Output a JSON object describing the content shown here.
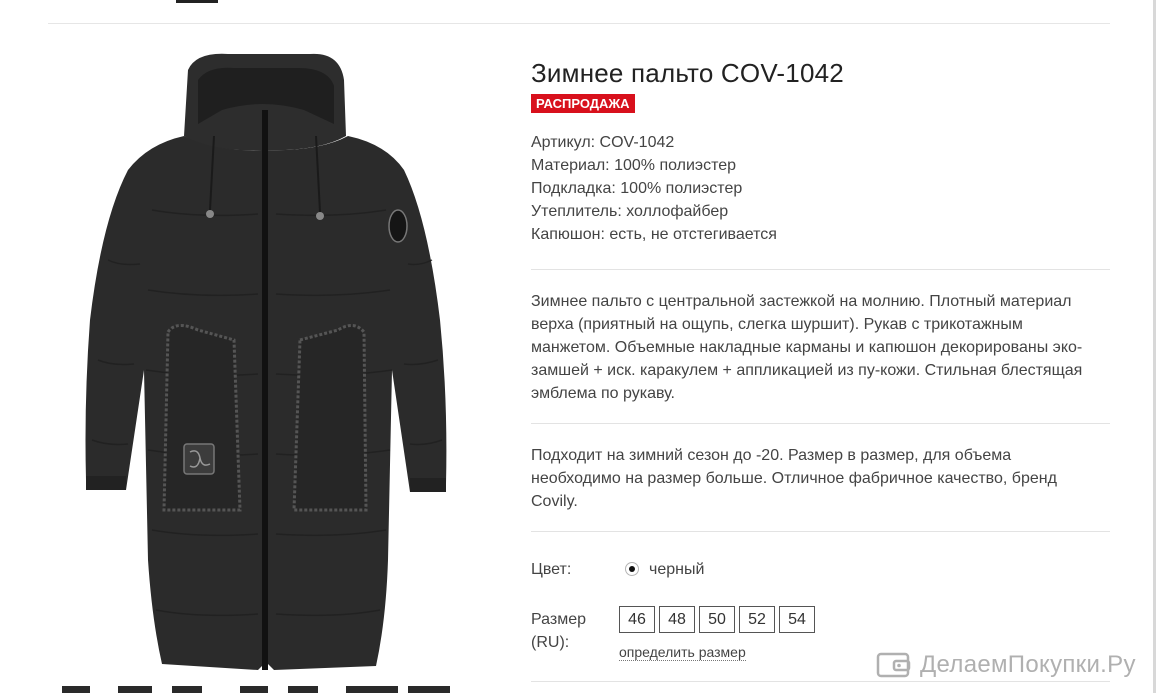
{
  "product": {
    "title": "Зимнее пальто COV-1042",
    "badge": "РАСПРОДАЖА",
    "specs": [
      {
        "label": "Артикул:",
        "value": "COV-1042"
      },
      {
        "label": "Материал:",
        "value": "100% полиэстер"
      },
      {
        "label": "Подкладка:",
        "value": "100% полиэстер"
      },
      {
        "label": "Утеплитель:",
        "value": "холлофайбер"
      },
      {
        "label": "Капюшон:",
        "value": "есть, не отстегивается"
      }
    ],
    "description_lines": [
      "Зимнее пальто с центральной застежкой на молнию. Плотный материал",
      "верха (приятный на ощупь, слегка шуршит). Рукав с трикотажным",
      "манжетом. Объемные накладные карманы и капюшон декорированы эко-",
      "замшей + иск. каракулем + аппликацией из пу-кожи. Стильная блестящая",
      "эмблема по рукаву."
    ],
    "fit_note_lines": [
      "Подходит на зимний сезон до -20.  Размер в размер, для объема",
      "необходимо на размер больше. Отличное фабричное качество, бренд",
      "Covily."
    ]
  },
  "options": {
    "color_label": "Цвет:",
    "color_value": "черный",
    "color_selected": true,
    "size_label_line1": "Размер",
    "size_label_line2": "(RU):",
    "sizes": [
      "46",
      "48",
      "50",
      "52",
      "54"
    ],
    "size_guide_link": "определить размер"
  },
  "watermark": {
    "text": "ДелаемПокупки.Ру",
    "icon": "wallet-icon"
  },
  "colors": {
    "sale_badge": "#d8101c",
    "text": "#444444",
    "coat": "#2b2b2b"
  }
}
